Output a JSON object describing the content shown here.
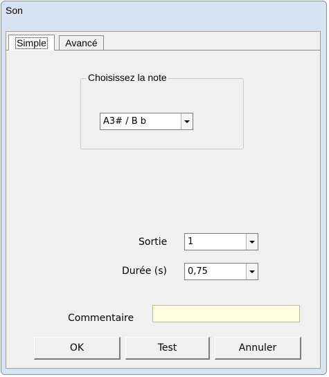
{
  "window": {
    "title": "Son"
  },
  "tabs": [
    {
      "label": "Simple",
      "active": true
    },
    {
      "label": "Avancé",
      "active": false
    }
  ],
  "note_group": {
    "label": "Choisissez la note",
    "selected": "A3# / B b"
  },
  "sortie": {
    "label": "Sortie",
    "selected": "1"
  },
  "duree": {
    "label": "Durée (s)",
    "selected": "0,75"
  },
  "commentaire": {
    "label": "Commentaire",
    "value": ""
  },
  "buttons": {
    "ok": "OK",
    "test": "Test",
    "cancel": "Annuler"
  },
  "colors": {
    "frame": "#d6e3f1",
    "client": "#f0f0f0",
    "comment_bg": "#ffffe1"
  }
}
